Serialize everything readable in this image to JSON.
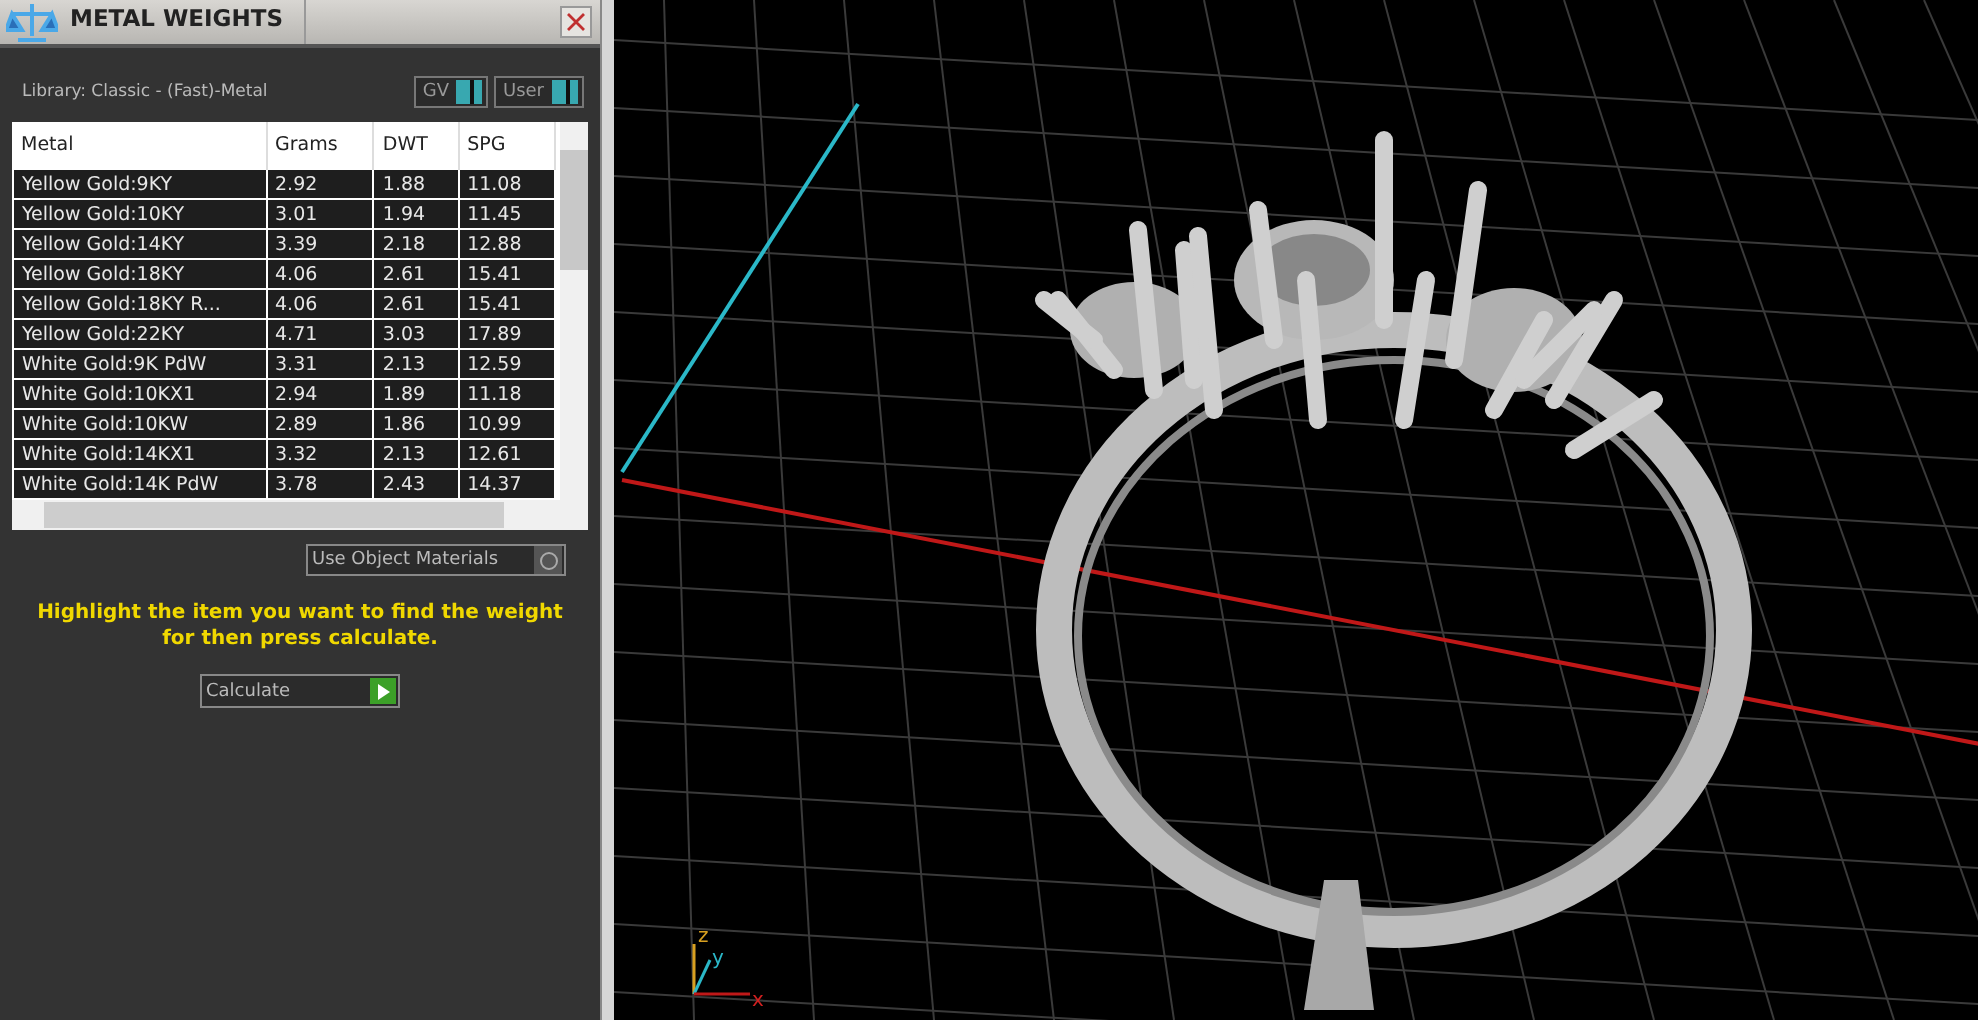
{
  "panel": {
    "title": "METAL WEIGHTS",
    "library": "Library: Classic - (Fast)-Metal",
    "toggles": [
      {
        "label": "GV",
        "on": true
      },
      {
        "label": "User",
        "on": true
      }
    ],
    "table": {
      "columns": [
        "Metal",
        "Grams",
        "DWT",
        "SPG"
      ],
      "rows": [
        [
          "Yellow Gold:9KY",
          "2.92",
          "1.88",
          "11.08"
        ],
        [
          "Yellow Gold:10KY",
          "3.01",
          "1.94",
          "11.45"
        ],
        [
          "Yellow Gold:14KY",
          "3.39",
          "2.18",
          "12.88"
        ],
        [
          "Yellow Gold:18KY",
          "4.06",
          "2.61",
          "15.41"
        ],
        [
          "Yellow Gold:18KY R...",
          "4.06",
          "2.61",
          "15.41"
        ],
        [
          "Yellow Gold:22KY",
          "4.71",
          "3.03",
          "17.89"
        ],
        [
          "White Gold:9K PdW",
          "3.31",
          "2.13",
          "12.59"
        ],
        [
          "White Gold:10KX1",
          "2.94",
          "1.89",
          "11.18"
        ],
        [
          "White Gold:10KW",
          "2.89",
          "1.86",
          "10.99"
        ],
        [
          "White Gold:14KX1",
          "3.32",
          "2.13",
          "12.61"
        ],
        [
          "White Gold:14K PdW",
          "3.78",
          "2.43",
          "14.37"
        ]
      ]
    },
    "object_materials": {
      "label": "Use Object Materials",
      "on": false
    },
    "message": "Highlight the item you want to find the weight for then press calculate.",
    "calculate_button": "Calculate"
  },
  "viewport": {
    "axes": [
      "z",
      "y",
      "x"
    ]
  }
}
